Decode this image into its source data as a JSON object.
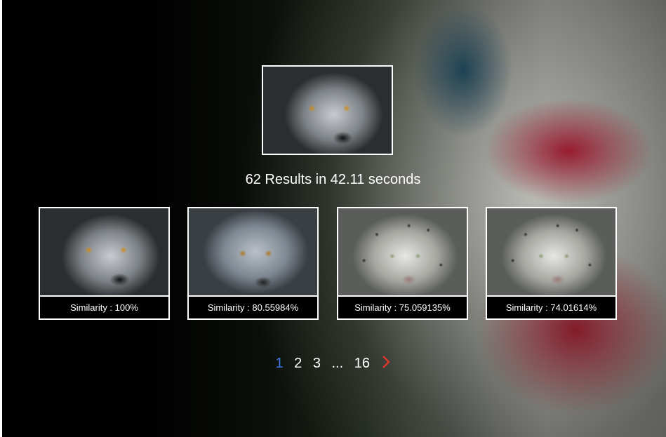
{
  "query": {
    "image_alt": "wolf query image"
  },
  "results_summary": "62 Results in 42.11 seconds",
  "results": [
    {
      "similarity": "Similarity : 100%",
      "subject": "wolf"
    },
    {
      "similarity": "Similarity : 80.55984%",
      "subject": "wolf"
    },
    {
      "similarity": "Similarity : 75.059135%",
      "subject": "snow-leopard"
    },
    {
      "similarity": "Similarity : 74.01614%",
      "subject": "snow-leopard"
    }
  ],
  "pagination": {
    "pages": [
      "1",
      "2",
      "3",
      "...",
      "16"
    ],
    "active": "1",
    "next_icon": "chevron-right-icon"
  },
  "colors": {
    "active_page": "#3b7be3",
    "next_arrow": "#e0362c",
    "border": "#ffffff"
  }
}
